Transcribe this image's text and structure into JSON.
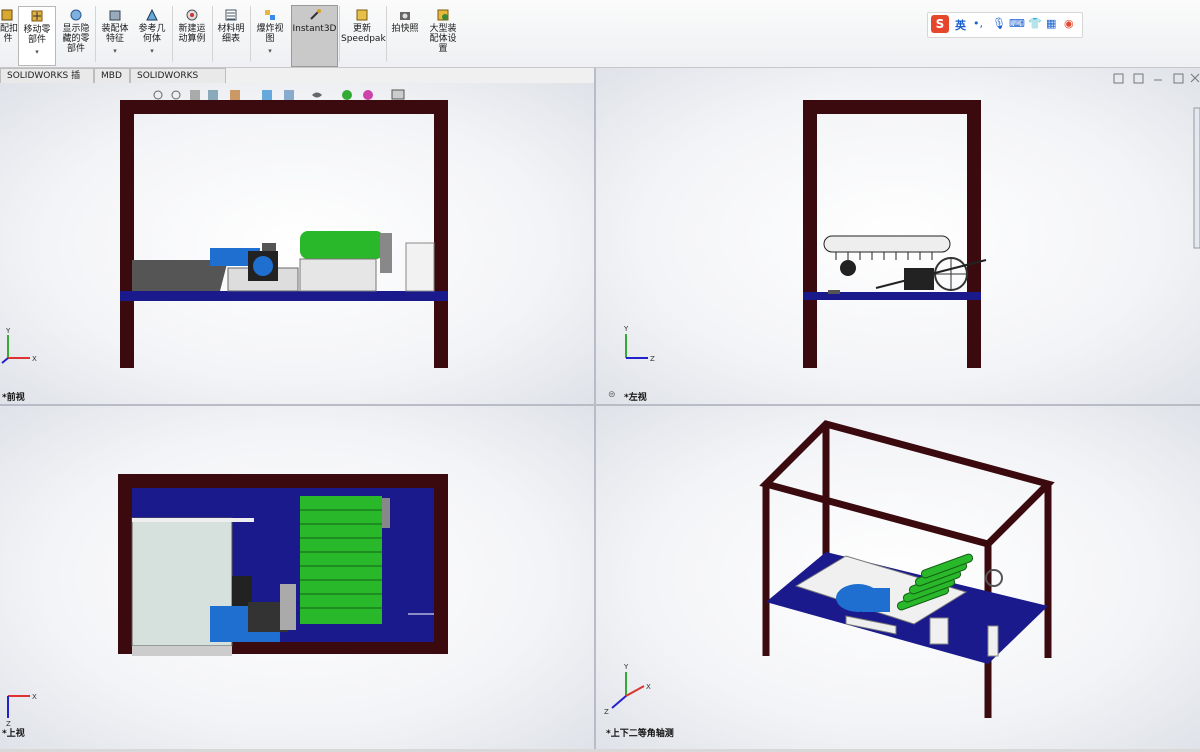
{
  "ribbon": {
    "items": [
      {
        "label": "配扣\n件",
        "icon": "mate-icon"
      },
      {
        "label": "移动零\n部件",
        "icon": "move-component-icon"
      },
      {
        "label": "显示隐\n藏的零\n部件",
        "icon": "show-hidden-icon"
      },
      {
        "label": "装配体\n特征",
        "icon": "assembly-feature-icon"
      },
      {
        "label": "参考几\n何体",
        "icon": "reference-geometry-icon"
      },
      {
        "label": "新建运\n动算例",
        "icon": "motion-study-icon"
      },
      {
        "label": "材料明\n细表",
        "icon": "bom-icon"
      },
      {
        "label": "爆炸视\n图",
        "icon": "exploded-view-icon"
      },
      {
        "label": "Instant3D",
        "icon": "instant3d-icon"
      },
      {
        "label": "更新\nSpeedpak",
        "icon": "speedpak-icon"
      },
      {
        "label": "拍快照",
        "icon": "snapshot-icon"
      },
      {
        "label": "大型装\n配体设\n置",
        "icon": "large-assembly-icon"
      }
    ]
  },
  "ime": {
    "lang": "英",
    "icons": [
      "sogou-logo-icon",
      "punctuation-icon",
      "microphone-icon",
      "keyboard-icon",
      "shirt-icon",
      "grid-icon",
      "face-icon"
    ]
  },
  "tabs": [
    "SOLIDWORKS 插件",
    "MBD",
    "SOLIDWORKS CAM"
  ],
  "viewports": {
    "front": {
      "label": "*前视"
    },
    "left": {
      "label": "*左视"
    },
    "top": {
      "label": "*上视"
    },
    "iso": {
      "label": "*上下二等角轴测"
    }
  },
  "colors": {
    "frame": "#3a0a0f",
    "plate": "#1a1a8c",
    "roller": "#28b82a",
    "motor": "#1e6fd0",
    "accent_active": "#c9c9c9"
  }
}
